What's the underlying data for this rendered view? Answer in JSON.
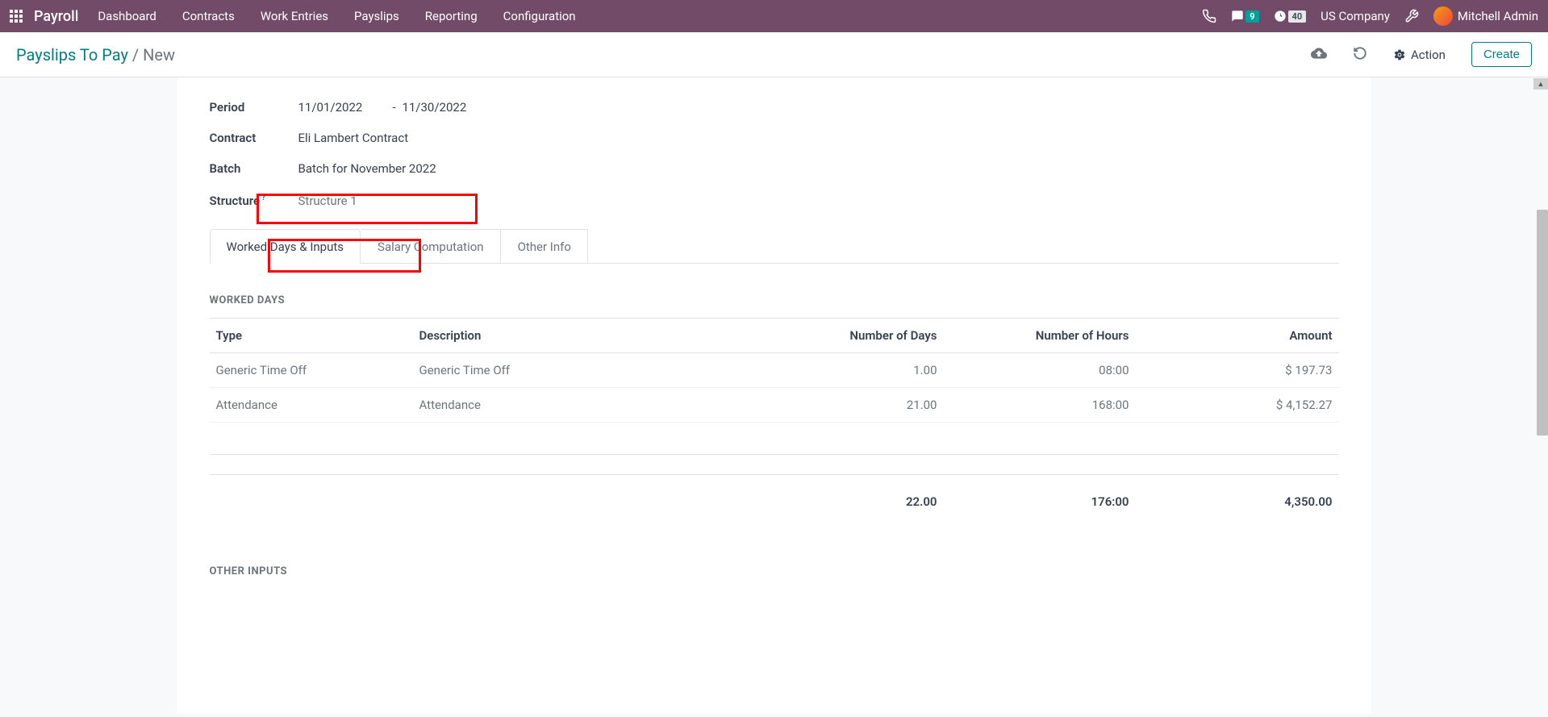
{
  "topbar": {
    "app_name": "Payroll",
    "nav": [
      "Dashboard",
      "Contracts",
      "Work Entries",
      "Payslips",
      "Reporting",
      "Configuration"
    ],
    "messages_badge": "9",
    "activities_badge": "40",
    "company": "US Company",
    "user": "Mitchell Admin"
  },
  "control": {
    "breadcrumb_parent": "Payslips To Pay",
    "breadcrumb_current": "New",
    "action_label": "Action",
    "create_label": "Create"
  },
  "form": {
    "period_label": "Period",
    "period_from": "11/01/2022",
    "period_sep": "-",
    "period_to": "11/30/2022",
    "contract_label": "Contract",
    "contract_value": "Eli Lambert Contract",
    "batch_label": "Batch",
    "batch_value": "Batch for November 2022",
    "structure_label": "Structure",
    "structure_value": "Structure 1"
  },
  "tabs": [
    "Worked Days & Inputs",
    "Salary Computation",
    "Other Info"
  ],
  "worked_days": {
    "section_title": "WORKED DAYS",
    "headers": {
      "type": "Type",
      "description": "Description",
      "days": "Number of Days",
      "hours": "Number of Hours",
      "amount": "Amount"
    },
    "rows": [
      {
        "type": "Generic Time Off",
        "description": "Generic Time Off",
        "days": "1.00",
        "hours": "08:00",
        "amount": "$ 197.73"
      },
      {
        "type": "Attendance",
        "description": "Attendance",
        "days": "21.00",
        "hours": "168:00",
        "amount": "$ 4,152.27"
      }
    ],
    "totals": {
      "days": "22.00",
      "hours": "176:00",
      "amount": "4,350.00"
    }
  },
  "other_inputs": {
    "section_title": "OTHER INPUTS"
  }
}
